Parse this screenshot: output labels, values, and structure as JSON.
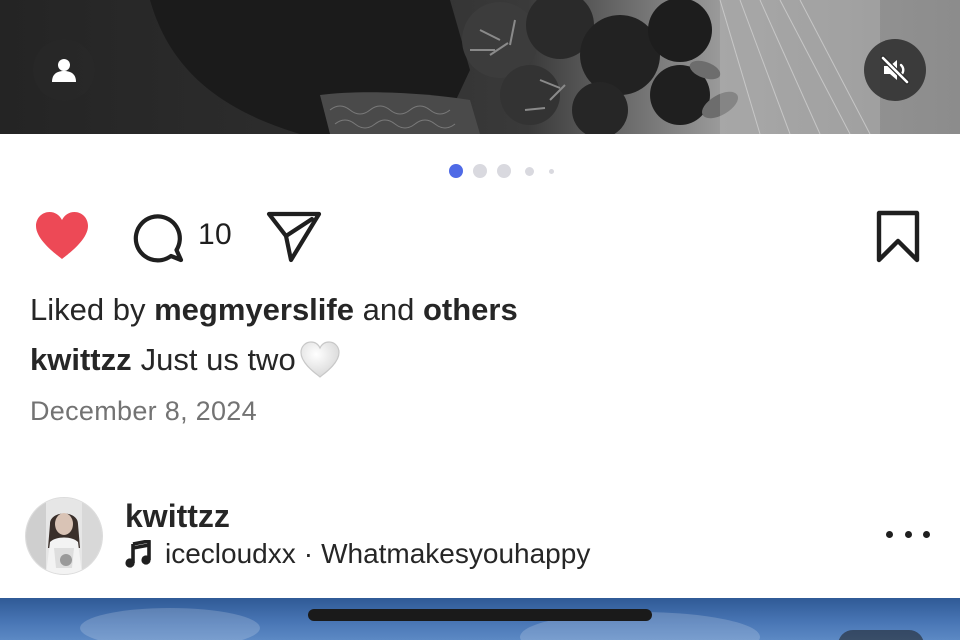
{
  "post": {
    "carousel": {
      "count": 5,
      "active_index": 0
    },
    "actions": {
      "liked": true,
      "comment_count": "10",
      "like_color": "#ED4956"
    },
    "likes": {
      "prefix": "Liked by",
      "user": "megmyerslife",
      "conjunction": "and",
      "others": "others"
    },
    "caption": {
      "username": "kwittzz",
      "text": "Just us two",
      "emoji": "white-heart"
    },
    "date": "December 8, 2024"
  },
  "next_post": {
    "username": "kwittzz",
    "music": {
      "artist": "icecloudxx",
      "separator": "·",
      "track": "Whatmakesyouhappy"
    }
  },
  "colors": {
    "accent_dot": "#4F6AE6",
    "muted_text": "#737373"
  }
}
